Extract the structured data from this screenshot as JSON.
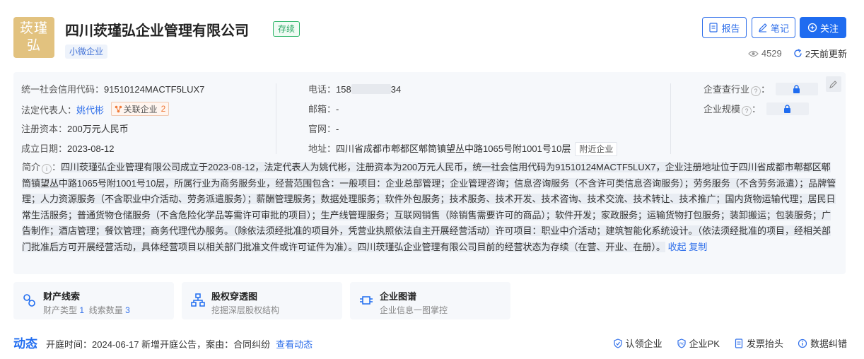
{
  "header": {
    "logo_text": "莰瑾弘",
    "company_name": "四川莰瑾弘企业管理有限公司",
    "status": "存续",
    "size_tag": "小微企业",
    "buttons": {
      "report": "报告",
      "notes": "笔记",
      "follow": "关注"
    },
    "views": "4529",
    "updated": "2天前更新"
  },
  "info": {
    "credit_code_label": "统一社会信用代码：",
    "credit_code": "91510124MACTF5LUX7",
    "legal_rep_label": "法定代表人：",
    "legal_rep": "姚代彬",
    "related_label": "关联企业",
    "related_count": "2",
    "capital_label": "注册资本：",
    "capital": "200万元人民币",
    "founded_label": "成立日期：",
    "founded": "2023-08-12",
    "phone_label": "电话：",
    "phone_prefix": "158",
    "phone_suffix": "34",
    "email_label": "邮箱：",
    "email": "-",
    "website_label": "官网：",
    "website": "-",
    "address_label": "地址：",
    "address": "四川省成都市郫都区郫筒镇望丛中路1065号附1001号10层",
    "nearby_label": "附近企业",
    "industry_label": "企查查行业",
    "scale_label": "企业规模",
    "intro_label": "简介",
    "intro": "四川莰瑾弘企业管理有限公司成立于2023-08-12，法定代表人为姚代彬，注册资本为200万元人民币，统一社会信用代码为91510124MACTF5LUX7，企业注册地址位于四川省成都市郫都区郫筒镇望丛中路1065号附1001号10层，所属行业为商务服务业，经营范围包含：一般项目：企业总部管理；企业管理咨询；信息咨询服务（不含许可类信息咨询服务）；劳务服务（不含劳务派遣）；品牌管理；人力资源服务（不含职业中介活动、劳务派遣服务）；薪酬管理服务；数据处理服务；软件外包服务；技术服务、技术开发、技术咨询、技术交流、技术转让、技术推广；国内货物运输代理；居民日常生活服务；普通货物仓储服务（不含危险化学品等需许可审批的项目）；生产线管理服务；互联网销售（除销售需要许可的商品）；软件开发；家政服务；运输货物打包服务；装卸搬运；包装服务；广告制作；酒店管理；餐饮管理；商务代理代办服务。（除依法须经批准的项目外，凭营业执照依法自主开展经营活动）许可项目：职业中介活动；建筑智能化系统设计。（依法须经批准的项目，经相关部门批准后方可开展经营活动，具体经营项目以相关部门批准文件或许可证件为准）。四川莰瑾弘企业管理有限公司目前的经营状态为存续（在营、开业、在册）。",
    "collapse": "收起",
    "copy": "复制"
  },
  "cards": [
    {
      "title": "财产线索",
      "sub_a_label": "财产类型",
      "sub_a_value": "1",
      "sub_b_label": "线索数量",
      "sub_b_value": "3"
    },
    {
      "title": "股权穿透图",
      "sub": "挖掘深层股权结构"
    },
    {
      "title": "企业图谱",
      "sub": "企业信息一图掌控"
    }
  ],
  "dynamics": {
    "title": "动态",
    "text": "开庭时间：2024-06-17 新增开庭公告，案由：合同纠纷",
    "link": "查看动态"
  },
  "actions": [
    "认领企业",
    "企业PK",
    "发票抬头",
    "数据纠错"
  ]
}
